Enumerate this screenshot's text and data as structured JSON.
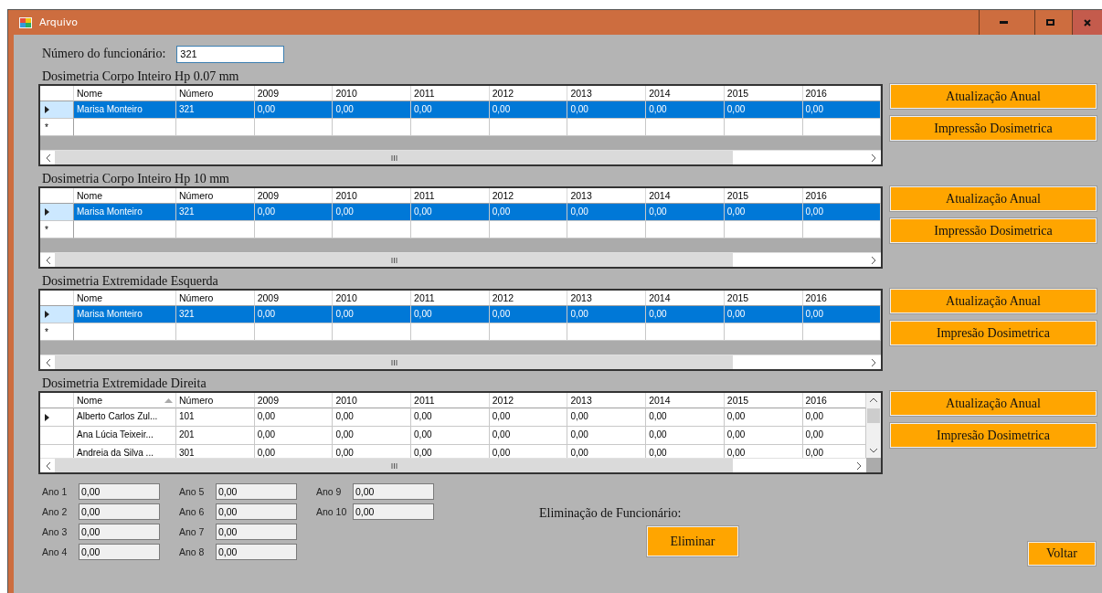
{
  "window": {
    "title": "Arquivo"
  },
  "employee_field": {
    "label": "Número do funcionário:",
    "value": "321"
  },
  "grids": [
    {
      "title": "Dosimetria Corpo Inteiro Hp 0.07 mm",
      "columns": [
        {
          "label": "Nome"
        },
        {
          "label": "Número"
        },
        {
          "label": "2009"
        },
        {
          "label": "2010"
        },
        {
          "label": "2011"
        },
        {
          "label": "2012"
        },
        {
          "label": "2013"
        },
        {
          "label": "2014"
        },
        {
          "label": "2015"
        },
        {
          "label": "2016"
        }
      ],
      "rows": [
        {
          "kind": "data",
          "current": true,
          "selected": true,
          "cells": [
            "Marisa Monteiro",
            "321",
            "0,00",
            "0,00",
            "0,00",
            "0,00",
            "0,00",
            "0,00",
            "0,00",
            "0,00"
          ]
        },
        {
          "kind": "new",
          "marker": "*",
          "current": false,
          "selected": false
        }
      ],
      "buttons": [
        "Atualização Anual",
        "Impressão Dosimetrica"
      ]
    },
    {
      "title": "Dosimetria Corpo Inteiro Hp 10 mm",
      "columns": [
        {
          "label": "Nome"
        },
        {
          "label": "Número"
        },
        {
          "label": "2009"
        },
        {
          "label": "2010"
        },
        {
          "label": "2011"
        },
        {
          "label": "2012"
        },
        {
          "label": "2013"
        },
        {
          "label": "2014"
        },
        {
          "label": "2015"
        },
        {
          "label": "2016"
        }
      ],
      "rows": [
        {
          "kind": "data",
          "current": true,
          "selected": true,
          "cells": [
            "Marisa Monteiro",
            "321",
            "0,00",
            "0,00",
            "0,00",
            "0,00",
            "0,00",
            "0,00",
            "0,00",
            "0,00"
          ]
        },
        {
          "kind": "new",
          "marker": "*",
          "current": false,
          "selected": false
        }
      ],
      "buttons": [
        "Atualização Anual",
        "Impressão Dosimetrica"
      ]
    },
    {
      "title": "Dosimetria Extremidade Esquerda",
      "columns": [
        {
          "label": "Nome"
        },
        {
          "label": "Número"
        },
        {
          "label": "2009"
        },
        {
          "label": "2010"
        },
        {
          "label": "2011"
        },
        {
          "label": "2012"
        },
        {
          "label": "2013"
        },
        {
          "label": "2014"
        },
        {
          "label": "2015"
        },
        {
          "label": "2016"
        }
      ],
      "rows": [
        {
          "kind": "data",
          "current": true,
          "selected": true,
          "cells": [
            "Marisa Monteiro",
            "321",
            "0,00",
            "0,00",
            "0,00",
            "0,00",
            "0,00",
            "0,00",
            "0,00",
            "0,00"
          ]
        },
        {
          "kind": "new",
          "marker": "*",
          "current": false,
          "selected": false
        }
      ],
      "buttons": [
        "Atualização Anual",
        "Impresão Dosimetrica"
      ]
    },
    {
      "title": "Dosimetria Extremidade Direita",
      "columns": [
        {
          "label": "Nome",
          "sorted": true
        },
        {
          "label": "Número",
          "sorted": false
        },
        {
          "label": "2009",
          "sorted": false
        },
        {
          "label": "2010",
          "sorted": false
        },
        {
          "label": "2011",
          "sorted": false
        },
        {
          "label": "2012",
          "sorted": false
        },
        {
          "label": "2013",
          "sorted": false
        },
        {
          "label": "2014",
          "sorted": false
        },
        {
          "label": "2015",
          "sorted": false
        },
        {
          "label": "2016",
          "sorted": false
        }
      ],
      "rows": [
        {
          "kind": "data",
          "current": true,
          "selected": false,
          "cells": [
            "Alberto Carlos Zul...",
            "101",
            "0,00",
            "0,00",
            "0,00",
            "0,00",
            "0,00",
            "0,00",
            "0,00",
            "0,00"
          ]
        },
        {
          "kind": "data",
          "current": false,
          "selected": false,
          "cells": [
            "Ana Lúcia Teixeir...",
            "201",
            "0,00",
            "0,00",
            "0,00",
            "0,00",
            "0,00",
            "0,00",
            "0,00",
            "0,00"
          ]
        },
        {
          "kind": "data",
          "current": false,
          "selected": false,
          "cells": [
            "Andreia da Silva ...",
            "301",
            "0,00",
            "0,00",
            "0,00",
            "0,00",
            "0,00",
            "0,00",
            "0,00",
            "0,00"
          ]
        }
      ],
      "buttons": [
        "Atualização Anual",
        "Impresão Dosimetrica"
      ]
    }
  ],
  "year_fields": [
    {
      "label": "Ano 1",
      "value": "0,00"
    },
    {
      "label": "Ano 2",
      "value": "0,00"
    },
    {
      "label": "Ano 3",
      "value": "0,00"
    },
    {
      "label": "Ano 4",
      "value": "0,00"
    },
    {
      "label": "Ano 5",
      "value": "0,00"
    },
    {
      "label": "Ano 6",
      "value": "0,00"
    },
    {
      "label": "Ano 7",
      "value": "0,00"
    },
    {
      "label": "Ano 8",
      "value": "0,00"
    },
    {
      "label": "Ano 9",
      "value": "0,00"
    },
    {
      "label": "Ano 10",
      "value": "0,00"
    }
  ],
  "delete": {
    "label": "Eliminação de Funcionário:",
    "button": "Eliminar"
  },
  "back_button": "Voltar"
}
